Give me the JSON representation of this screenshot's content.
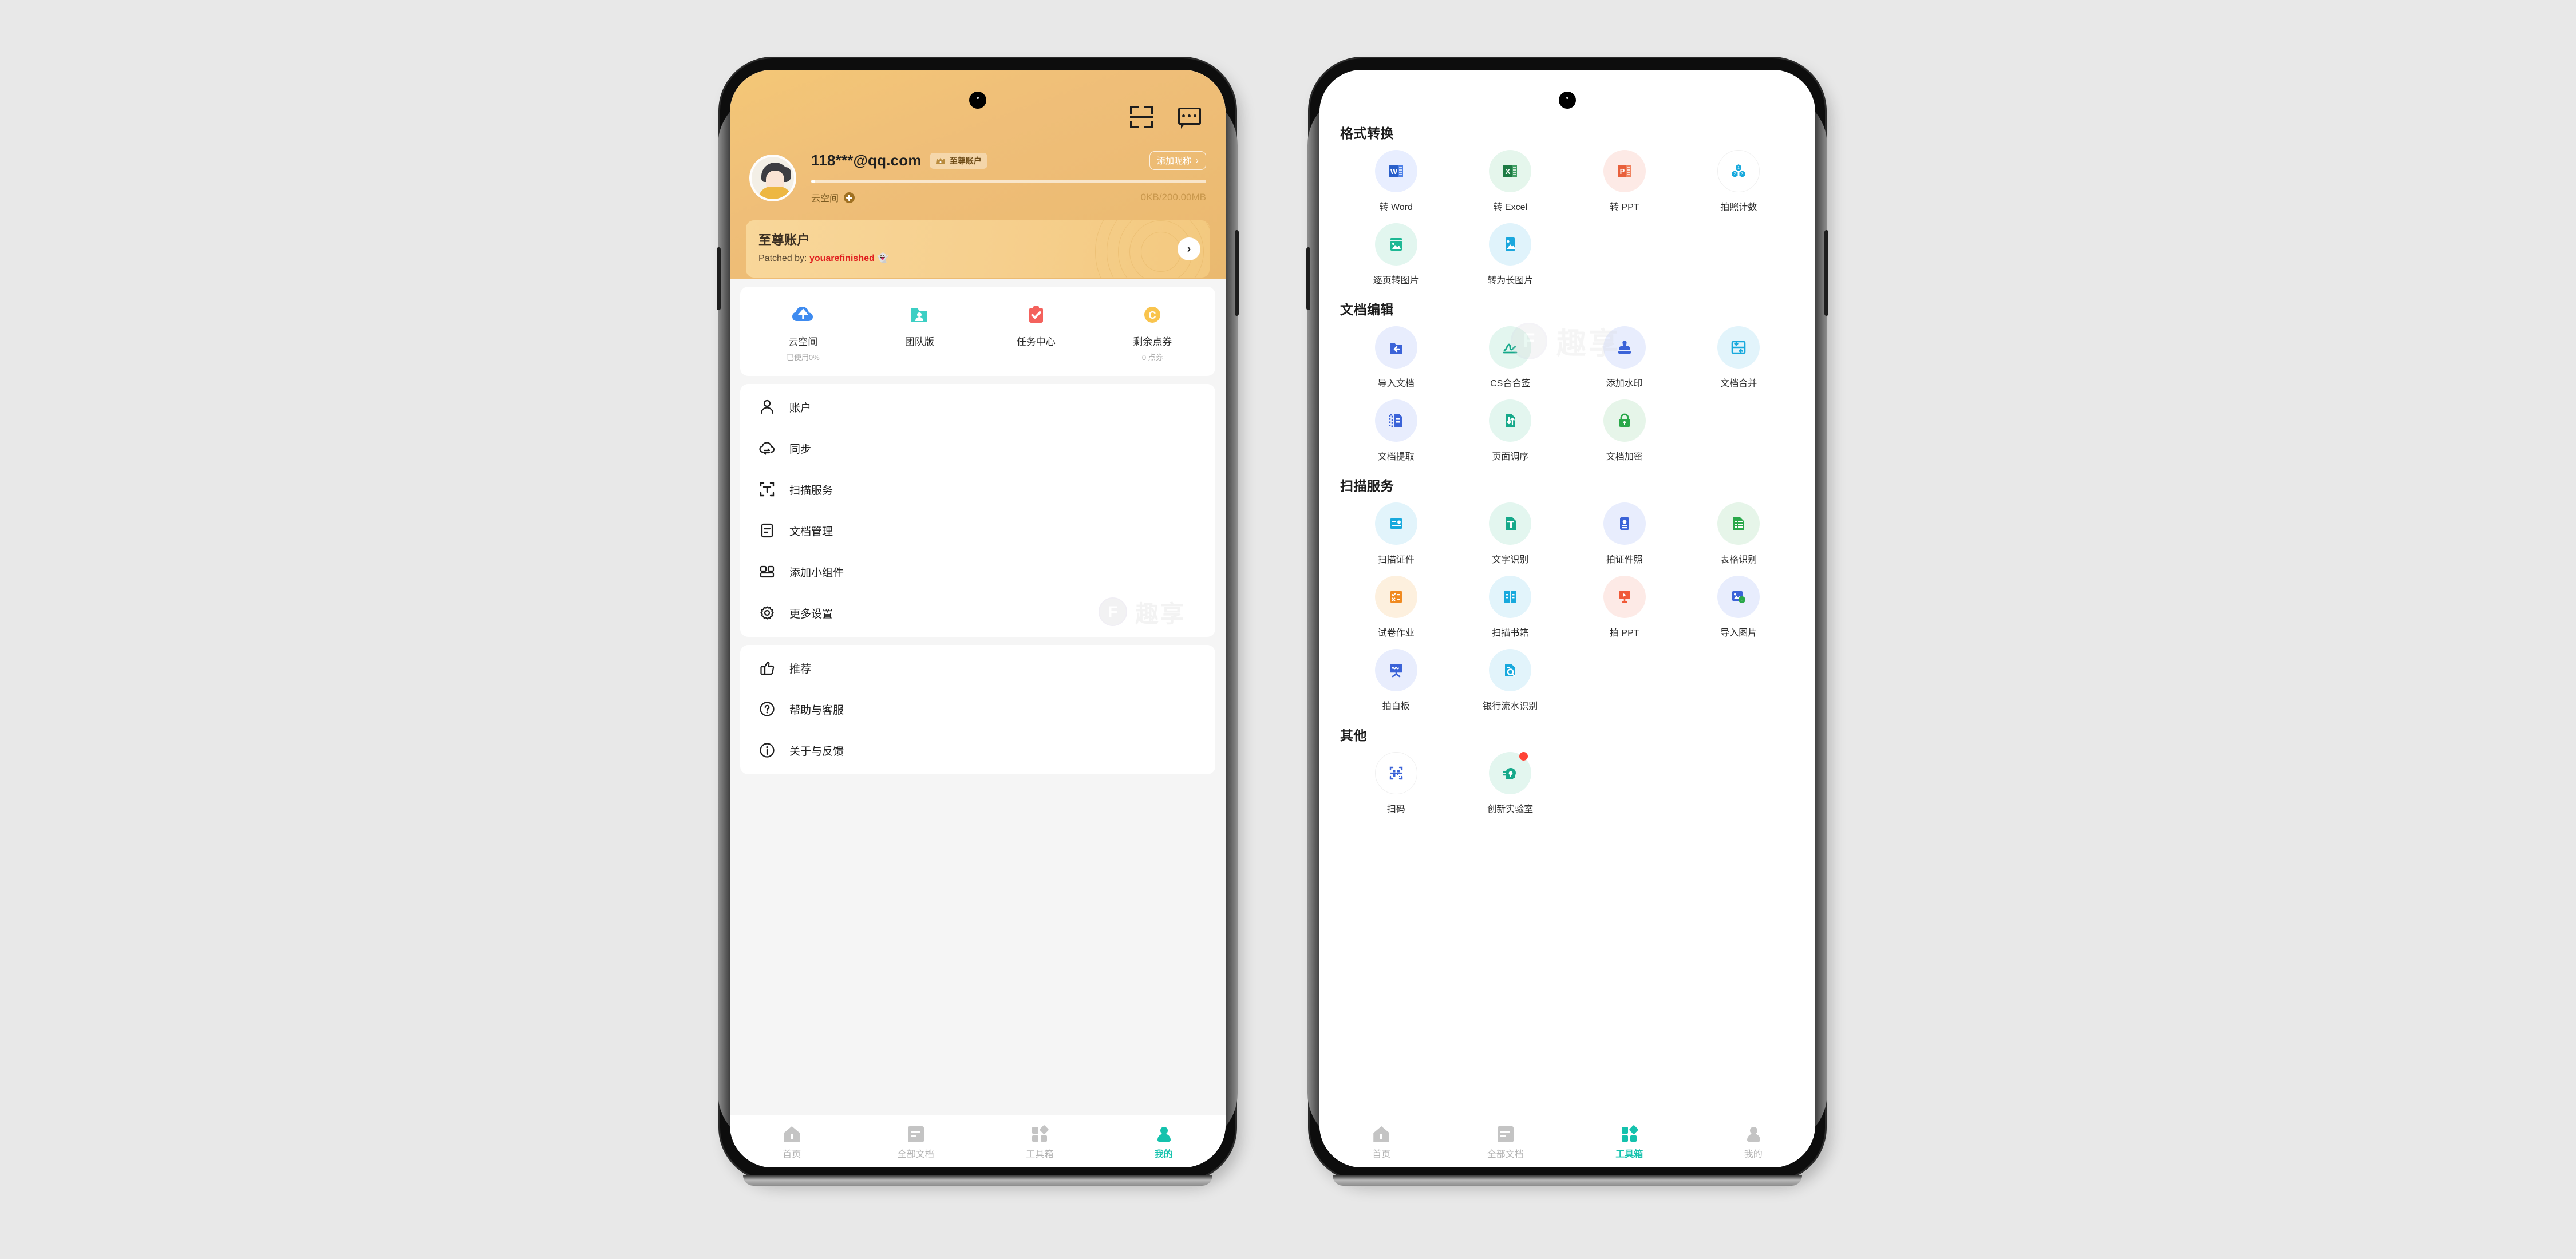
{
  "profile": {
    "header": {
      "scan_icon": "scan-icon",
      "message_icon": "message-icon"
    },
    "account": {
      "username": "118***@qq.com",
      "vip_badge": "至尊账户",
      "nickname_button": "添加昵称",
      "nickname_chevron": "›",
      "cloud_label": "云空间",
      "quota": "0KB/200.00MB",
      "progress_percent": 0
    },
    "promo": {
      "title": "至尊账户",
      "subtitle_prefix": "Patched by: ",
      "subtitle_highlight": "youarefinished",
      "subtitle_suffix": " 👻",
      "arrow": "›"
    },
    "quick_actions": [
      {
        "label": "云空间",
        "sub": "已使用0%",
        "icon": "cloud-upload-icon",
        "color": "#3e8bf0"
      },
      {
        "label": "团队版",
        "sub": "",
        "icon": "team-folder-icon",
        "color": "#3ccfc4"
      },
      {
        "label": "任务中心",
        "sub": "",
        "icon": "task-check-icon",
        "color": "#f4625d"
      },
      {
        "label": "剩余点券",
        "sub": "0 点券",
        "icon": "coupon-coin-icon",
        "color": "#f9c44d"
      }
    ],
    "menu_group_1": [
      {
        "label": "账户",
        "icon": "person-icon"
      },
      {
        "label": "同步",
        "icon": "cloud-sync-icon"
      },
      {
        "label": "扫描服务",
        "icon": "scan-text-icon"
      },
      {
        "label": "文档管理",
        "icon": "document-icon"
      },
      {
        "label": "添加小组件",
        "icon": "widget-icon"
      },
      {
        "label": "更多设置",
        "icon": "gear-icon"
      }
    ],
    "menu_group_2": [
      {
        "label": "推荐",
        "icon": "thumbs-up-icon"
      },
      {
        "label": "帮助与客服",
        "icon": "question-circle-icon"
      },
      {
        "label": "关于与反馈",
        "icon": "info-circle-icon"
      }
    ],
    "watermark": {
      "badge": "F",
      "text": "趣享"
    },
    "tabs": [
      {
        "label": "首页",
        "icon": "home-icon",
        "active": false
      },
      {
        "label": "全部文档",
        "icon": "documents-icon",
        "active": false
      },
      {
        "label": "工具箱",
        "icon": "toolbox-icon",
        "active": false
      },
      {
        "label": "我的",
        "icon": "profile-icon",
        "active": true
      }
    ]
  },
  "toolbox": {
    "sections": [
      {
        "title": "格式转换",
        "items": [
          {
            "label": "转 Word",
            "icon": "word-icon",
            "bubble": "#e8eeff",
            "color": "#2a5fc9"
          },
          {
            "label": "转 Excel",
            "icon": "excel-icon",
            "bubble": "#e5f6ec",
            "color": "#1e7b45"
          },
          {
            "label": "转 PPT",
            "icon": "ppt-icon",
            "bubble": "#fdeae6",
            "color": "#e8603c"
          },
          {
            "label": "拍照计数",
            "icon": "photo-count-icon",
            "bubble": "#ffffff",
            "color": "#17a9dd"
          },
          {
            "label": "逐页转图片",
            "icon": "page-to-image-icon",
            "bubble": "#e2f6ef",
            "color": "#1db894"
          },
          {
            "label": "转为长图片",
            "icon": "long-image-icon",
            "bubble": "#e0f3fb",
            "color": "#1aa7dd"
          }
        ]
      },
      {
        "title": "文档编辑",
        "items": [
          {
            "label": "导入文档",
            "icon": "import-doc-icon",
            "bubble": "#e8edfd",
            "color": "#3b63d8"
          },
          {
            "label": "CS合合签",
            "icon": "signature-icon",
            "bubble": "#e3f6ef",
            "color": "#16a98a"
          },
          {
            "label": "添加水印",
            "icon": "stamp-icon",
            "bubble": "#e8edfd",
            "color": "#3b63d8"
          },
          {
            "label": "文档合并",
            "icon": "merge-doc-icon",
            "bubble": "#e2f4fb",
            "color": "#17a9dd"
          },
          {
            "label": "文档提取",
            "icon": "extract-doc-icon",
            "bubble": "#e8edfd",
            "color": "#3b63d8"
          },
          {
            "label": "页面调序",
            "icon": "reorder-page-icon",
            "bubble": "#e3f6ef",
            "color": "#16a98a"
          },
          {
            "label": "文档加密",
            "icon": "lock-doc-icon",
            "bubble": "#e6f5e9",
            "color": "#2aa84a"
          }
        ]
      },
      {
        "title": "扫描服务",
        "items": [
          {
            "label": "扫描证件",
            "icon": "scan-id-icon",
            "bubble": "#e2f4fb",
            "color": "#17a9dd"
          },
          {
            "label": "文字识别",
            "icon": "ocr-text-icon",
            "bubble": "#e3f6ef",
            "color": "#16a98a"
          },
          {
            "label": "拍证件照",
            "icon": "id-photo-icon",
            "bubble": "#e8edfd",
            "color": "#3b63d8"
          },
          {
            "label": "表格识别",
            "icon": "table-ocr-icon",
            "bubble": "#e6f5e9",
            "color": "#2aa84a"
          },
          {
            "label": "试卷作业",
            "icon": "exam-paper-icon",
            "bubble": "#fdf0de",
            "color": "#f08a20"
          },
          {
            "label": "扫描书籍",
            "icon": "scan-book-icon",
            "bubble": "#e2f4fb",
            "color": "#17a9dd"
          },
          {
            "label": "拍 PPT",
            "icon": "shoot-ppt-icon",
            "bubble": "#fdeae6",
            "color": "#f05a38"
          },
          {
            "label": "导入图片",
            "icon": "import-image-icon",
            "bubble": "#e8edfd",
            "color": "#3b63d8"
          },
          {
            "label": "拍白板",
            "icon": "whiteboard-icon",
            "bubble": "#e8edfd",
            "color": "#3b63d8"
          },
          {
            "label": "银行流水识别",
            "icon": "bank-statement-icon",
            "bubble": "#e2f4fb",
            "color": "#17a9dd"
          }
        ]
      },
      {
        "title": "其他",
        "items": [
          {
            "label": "扫码",
            "icon": "qr-scan-icon",
            "bubble": "#ffffff",
            "color": "#3b63d8",
            "badge": false
          },
          {
            "label": "创新实验室",
            "icon": "lab-head-icon",
            "bubble": "#e3f6ef",
            "color": "#16a98a",
            "badge": true
          }
        ]
      }
    ],
    "watermark": {
      "badge": "F",
      "text": "趣享"
    },
    "tabs": [
      {
        "label": "首页",
        "icon": "home-icon",
        "active": false
      },
      {
        "label": "全部文档",
        "icon": "documents-icon",
        "active": false
      },
      {
        "label": "工具箱",
        "icon": "toolbox-icon",
        "active": true
      },
      {
        "label": "我的",
        "icon": "profile-icon",
        "active": false
      }
    ]
  },
  "theme": {
    "accent": "#14c2ad",
    "hero_gradient_from": "#f4c777",
    "hero_gradient_to": "#eab96f",
    "page_bg": "#e8e8e8",
    "highlight_red": "#e02020"
  }
}
